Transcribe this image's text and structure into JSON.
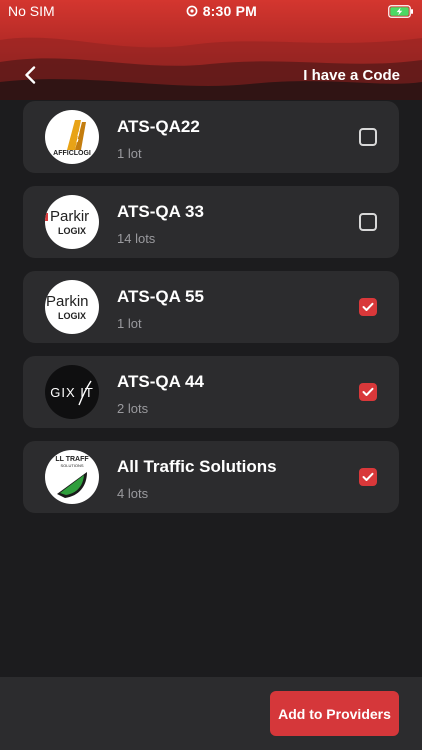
{
  "status_bar": {
    "carrier": "No SIM",
    "time": "8:30 PM",
    "battery_icon": "battery-charging-icon",
    "battery_color": "#4cd964"
  },
  "nav": {
    "back_icon": "chevron-left-icon",
    "code_label": "I have a Code"
  },
  "colors": {
    "accent": "#d5373a",
    "background": "#1c1c1e",
    "card": "#2c2c2e"
  },
  "providers": [
    {
      "name": "ATS-QA22",
      "lots": "1 lot",
      "checked": false,
      "logo_text": "AFFICLOGI"
    },
    {
      "name": "ATS-QA 33",
      "lots": "14 lots",
      "checked": false,
      "logo_text_1": "Parkir",
      "logo_text_2": "LOGIX"
    },
    {
      "name": "ATS-QA 55",
      "lots": "1 lot",
      "checked": true,
      "logo_text_1": "Parkin",
      "logo_text_2": "LOGIX"
    },
    {
      "name": "ATS-QA 44",
      "lots": "2 lots",
      "checked": true,
      "logo_text": "GIX IT"
    },
    {
      "name": "All Traffic Solutions",
      "lots": "4 lots",
      "checked": true,
      "logo_text_1": "LL TRAFF",
      "logo_text_2": "SOLUTIONS"
    }
  ],
  "footer": {
    "add_label": "Add to Providers"
  }
}
